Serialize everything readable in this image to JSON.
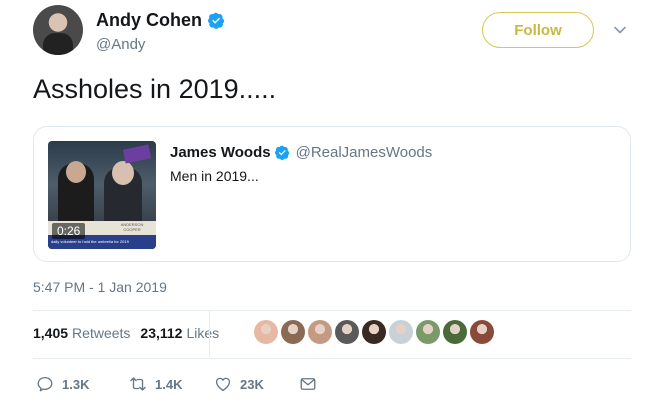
{
  "author": {
    "display_name": "Andy Cohen",
    "handle": "@Andy",
    "verified": true,
    "avatar": "avatar"
  },
  "follow_label": "Follow",
  "tweet_text": "Assholes in 2019.....",
  "quoted": {
    "display_name": "James Woods",
    "handle": "@RealJamesWoods",
    "text": "Men in 2019...",
    "video_duration": "0:26",
    "video_brand": "ANDERSON COOPER",
    "video_ticker": "daily volunteer to hold the umbrella for 2019"
  },
  "timestamp": "5:47 PM - 1 Jan 2019",
  "stats": {
    "retweets_count": "1,405",
    "retweets_label": "Retweets",
    "likes_count": "23,112",
    "likes_label": "Likes"
  },
  "liker_avatars": [
    "#e8b9a2",
    "#8a6a55",
    "#c49a82",
    "#5a5a5a",
    "#3a2a22",
    "#c8d0d8",
    "#7a9a6a",
    "#4a6a3a",
    "#8a4a3a"
  ],
  "actions": {
    "reply_count": "1.3K",
    "retweet_count": "1.4K",
    "like_count": "23K"
  },
  "colors": {
    "follow_accent": "#c9b840",
    "verified": "#1da1f2",
    "muted": "#657786"
  }
}
